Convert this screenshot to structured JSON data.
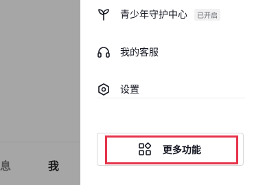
{
  "bottom_nav": {
    "partial_tab_label": "息",
    "me_tab_label": "我"
  },
  "drawer": {
    "items": [
      {
        "label": "青少年守护中心",
        "badge": "已开启",
        "icon": "sprout-icon"
      },
      {
        "label": "我的客服",
        "icon": "headset-icon"
      },
      {
        "label": "设置",
        "icon": "hexagon-settings-icon"
      }
    ],
    "more_button": {
      "label": "更多功能",
      "icon": "grid-apps-icon"
    }
  },
  "colors": {
    "overlay": "#a6a6a6",
    "highlight": "#e6334a",
    "text": "#161823"
  }
}
